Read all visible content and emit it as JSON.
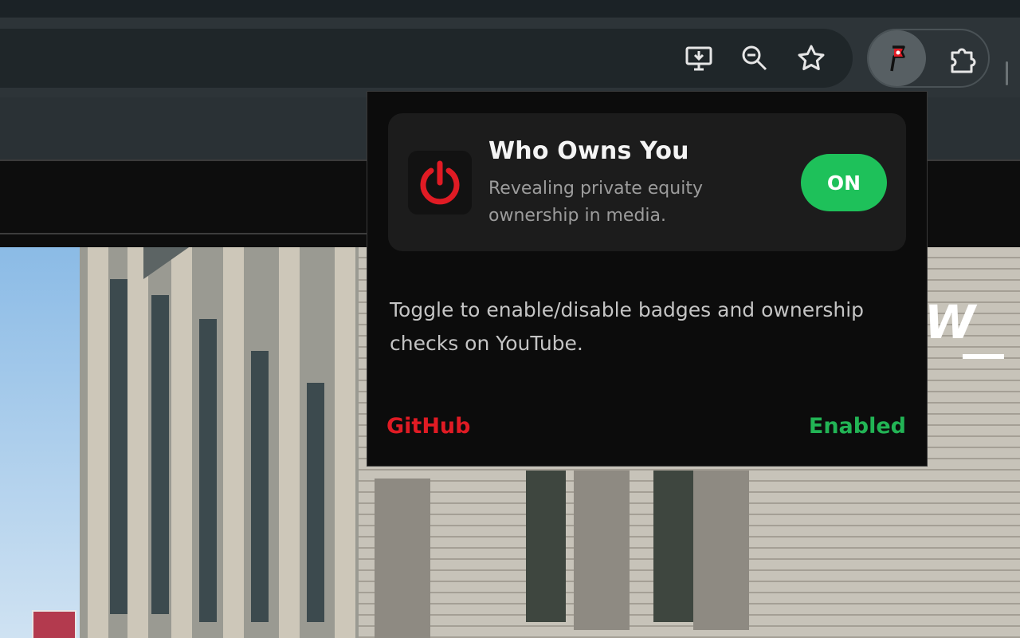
{
  "browser": {
    "toolbar_icons": [
      "install-app-icon",
      "zoom-icon",
      "bookmark-star-icon",
      "extension-pin-icon",
      "extensions-puzzle-icon"
    ]
  },
  "popup": {
    "app_title": "Who Owns You",
    "app_subtitle": "Revealing private equity ownership in media.",
    "toggle_label": "ON",
    "description": "Toggle to enable/disable badges and ownership checks on YouTube.",
    "github_link": "GitHub",
    "status": "Enabled",
    "colors": {
      "accent_red": "#e01b24",
      "toggle_green": "#1ec15a",
      "status_green": "#22b455",
      "background": "#0c0c0c",
      "card": "#1c1c1c"
    }
  }
}
